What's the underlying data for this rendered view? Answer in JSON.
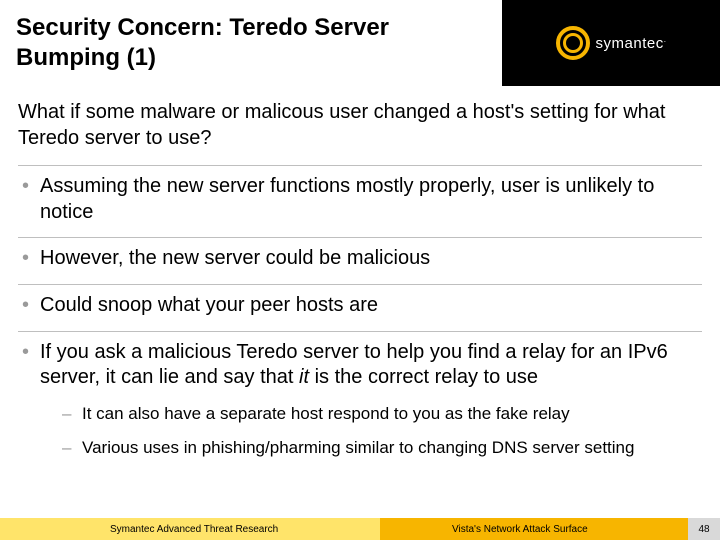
{
  "header": {
    "title": "Security Concern: Teredo Server Bumping (1)",
    "brand": "symantec",
    "trademark": "."
  },
  "content": {
    "intro": "What if some malware or malicous user changed a host's setting for what Teredo server to use?",
    "bullets": [
      {
        "text": "Assuming the new server functions mostly properly, user is unlikely to notice"
      },
      {
        "text": "However, the new server could be malicious"
      },
      {
        "text": "Could snoop what your peer hosts are"
      },
      {
        "prefix": "If you ask a malicious Teredo server to help you find a relay for an IPv6 server, it can lie and say that ",
        "italic": "it",
        "suffix": " is the correct relay to use",
        "sub": [
          "It can also have a separate host respond to you as the fake relay",
          "Various uses in phishing/pharming similar to changing DNS server setting"
        ]
      }
    ]
  },
  "footer": {
    "left": "Symantec Advanced Threat Research",
    "right": "Vista's Network Attack Surface",
    "page": "48"
  }
}
